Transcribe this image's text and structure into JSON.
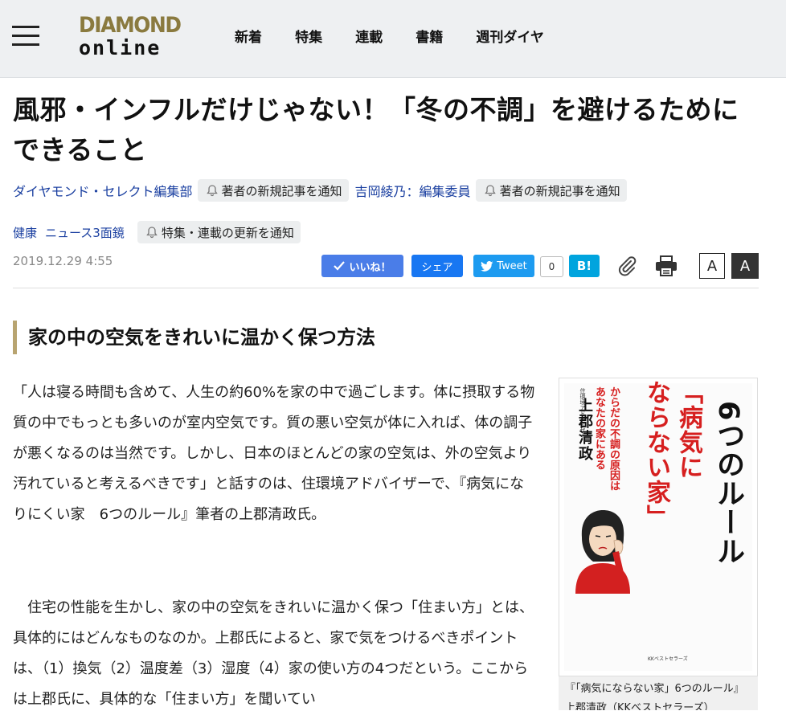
{
  "header": {
    "logo_line1": "DIAMOND",
    "logo_line2": "online",
    "nav": [
      "新着",
      "特集",
      "連載",
      "書籍",
      "週刊ダイヤ"
    ]
  },
  "article": {
    "title": "風邪・インフルだけじゃない！「冬の不調」を避けるためにできること",
    "authors": [
      {
        "name": "ダイヤモンド・セレクト編集部",
        "notify": "著者の新規記事を通知"
      },
      {
        "name": "吉岡綾乃：編集委員",
        "notify": "著者の新規記事を通知"
      }
    ],
    "tags": [
      "健康",
      "ニュース3面鏡"
    ],
    "tag_notify": "特集・連載の更新を通知",
    "date": "2019.12.29 4:55",
    "heading": "家の中の空気をきれいに温かく保つ方法",
    "paragraphs": [
      "「人は寝る時間も含めて、人生の約60%を家の中で過ごします。体に摂取する物質の中でもっとも多いのが室内空気です。質の悪い空気が体に入れば、体の調子が悪くなるのは当然です。しかし、日本のほとんどの家の空気は、外の空気より汚れていると考えるべきです」と話すのは、住環境アドバイザーで、『病気になりにくい家　6つのルール』筆者の上郡清政氏。",
      "　住宅の性能を生かし、家の中の空気をきれいに温かく保つ「住まい方」とは、具体的にはどんなものなのか。上郡氏によると、家で気をつけるべきポイントは、（1）換気（2）温度差（3）湿度（4）家の使い方の4つだという。ここからは上郡氏に、具体的な「住まい方」を聞いてい"
    ]
  },
  "social": {
    "like": "いいね！",
    "share": "シェア",
    "tweet": "Tweet",
    "tweet_count": "0",
    "hatena": "B!",
    "font_small": "A",
    "font_large": "A"
  },
  "book": {
    "author_label": "住環境アドバイザー",
    "author": "上郡清政",
    "sub_copy": [
      "からだの不調の原因は",
      "あなたの家にある"
    ],
    "title_red": [
      "「病気に",
      "ならない家」"
    ],
    "title_black": "6つのルール",
    "publisher": "KKベストセラーズ",
    "caption": "『「病気にならない家」6つのルール』上郡清政（KKベストセラーズ）"
  },
  "colors": {
    "header_bg": "#eef0f2",
    "link": "#1a3fa0",
    "accent_bar": "#b8a470",
    "book_red": "#d61f1f"
  }
}
